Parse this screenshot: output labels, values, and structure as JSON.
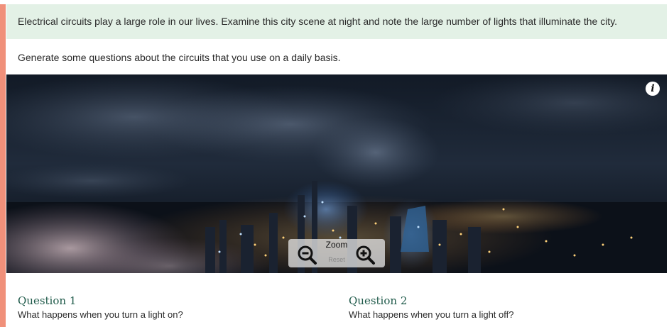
{
  "intro": {
    "text": "Electrical circuits play a large role in our lives. Examine this city scene at night and note the large number of lights that illuminate the city."
  },
  "prompt": {
    "text": "Generate some questions about the circuits that you use on a daily basis."
  },
  "image": {
    "info_icon": "info-icon",
    "info_glyph": "i",
    "zoom": {
      "label": "Zoom",
      "reset_label": "Reset",
      "zoom_out_icon": "zoom-out-icon",
      "zoom_in_icon": "zoom-in-icon"
    }
  },
  "questions": [
    {
      "title": "Question 1",
      "text": "What happens when you turn a light on?"
    },
    {
      "title": "Question 2",
      "text": "What happens when you turn a light off?"
    }
  ],
  "colors": {
    "accent_bar": "#f0907a",
    "intro_background": "#e3f1e6",
    "question_title": "#1f5a4a"
  }
}
